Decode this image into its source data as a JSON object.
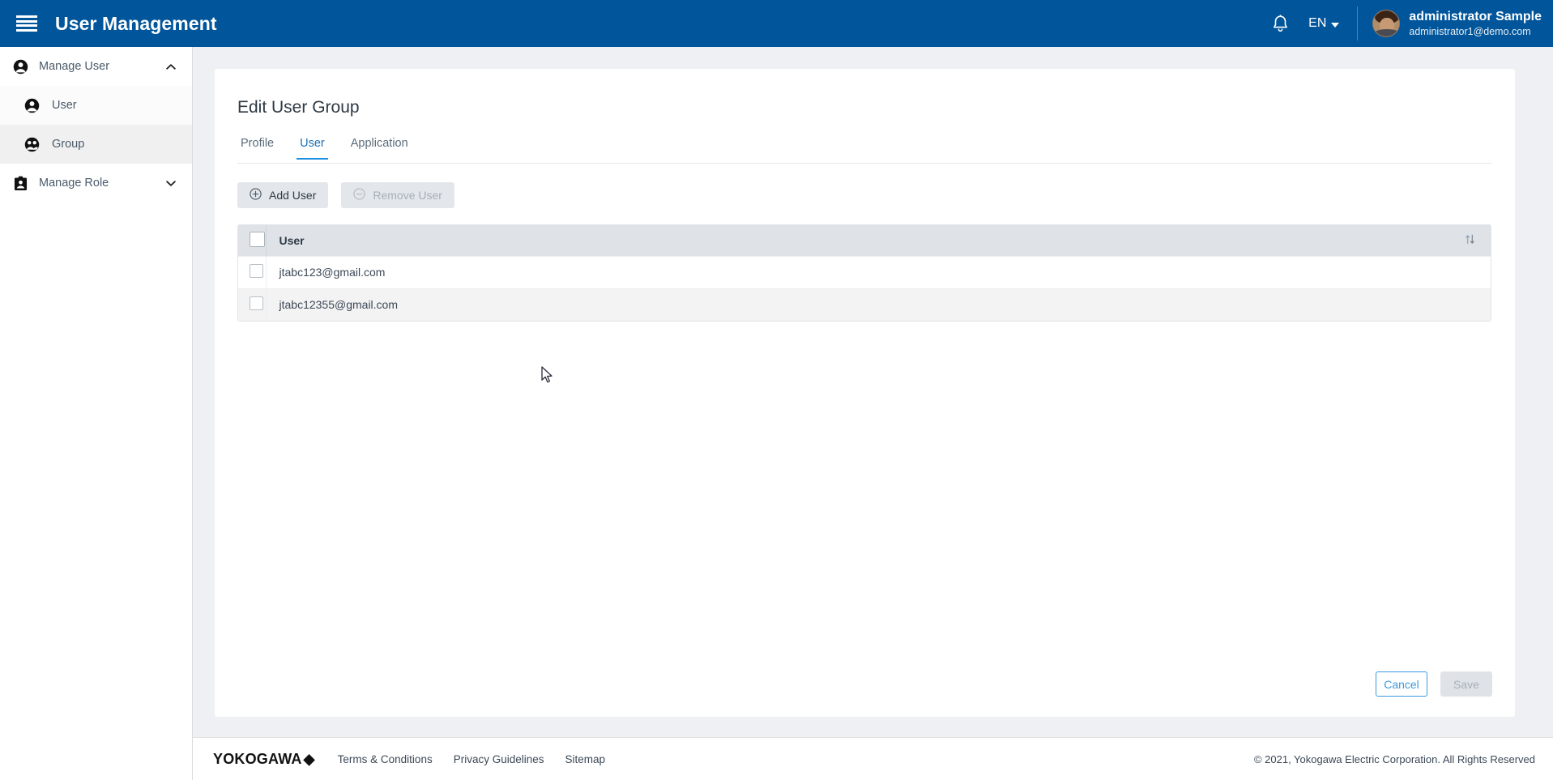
{
  "header": {
    "menu_icon": "hamburger-menu-icon",
    "title": "User Management",
    "notification_icon": "bell-icon",
    "language": "EN",
    "user_name": "administrator Sample",
    "user_email": "administrator1@demo.com",
    "brand_color": "#00559b"
  },
  "sidebar": {
    "items": [
      {
        "label": "Manage User",
        "icon": "person-icon",
        "chevron": "chevron-up-icon",
        "level": "parent",
        "expanded": true,
        "active": false
      },
      {
        "label": "User",
        "icon": "person-icon",
        "level": "child",
        "active": false
      },
      {
        "label": "Group",
        "icon": "group-icon",
        "level": "child",
        "active": true
      },
      {
        "label": "Manage Role",
        "icon": "badge-icon",
        "chevron": "chevron-down-icon",
        "level": "parent",
        "expanded": false,
        "active": false
      }
    ]
  },
  "main": {
    "page_title": "Edit User Group",
    "tabs": [
      {
        "label": "Profile",
        "active": false
      },
      {
        "label": "User",
        "active": true
      },
      {
        "label": "Application",
        "active": false
      }
    ],
    "toolbar": {
      "add_user_label": "Add User",
      "add_user_icon": "plus-circle-icon",
      "remove_user_label": "Remove User",
      "remove_user_icon": "minus-circle-icon",
      "remove_user_disabled": true
    },
    "table": {
      "columns": [
        "User"
      ],
      "sort_icon": "sort-updown-icon",
      "select_all_checked": false,
      "rows": [
        {
          "user": "jtabc123@gmail.com",
          "checked": false
        },
        {
          "user": "jtabc12355@gmail.com",
          "checked": false
        }
      ]
    },
    "actions": {
      "cancel_label": "Cancel",
      "save_label": "Save",
      "save_disabled": true
    },
    "accent_color": "#1a8fe0"
  },
  "footer": {
    "logo_text": "YOKOGAWA",
    "logo_mark": "◆",
    "links": [
      "Terms & Conditions",
      "Privacy Guidelines",
      "Sitemap"
    ],
    "copyright": "© 2021, Yokogawa Electric Corporation. All Rights Reserved"
  }
}
